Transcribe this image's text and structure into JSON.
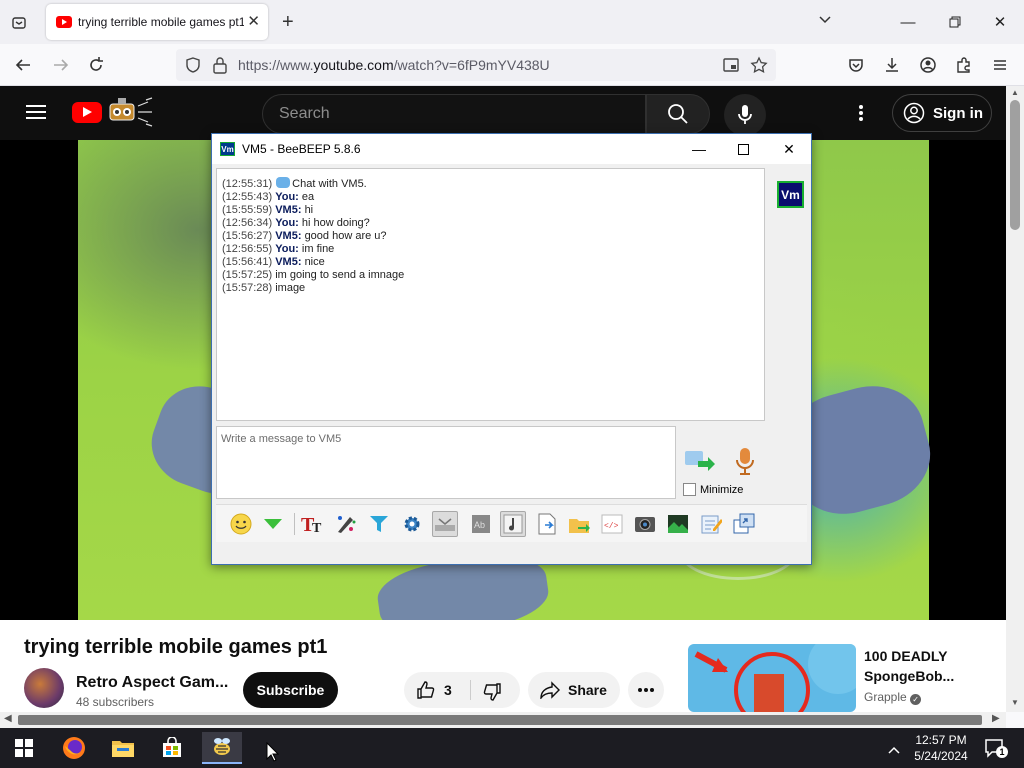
{
  "browser": {
    "tab_title": "trying terrible mobile games pt1",
    "url_prefix": "https://www.",
    "url_domain": "youtube.com",
    "url_suffix": "/watch?v=6fP9mYV438U"
  },
  "youtube": {
    "search_placeholder": "Search",
    "sign_in": "Sign in",
    "video_title": "trying terrible mobile games pt1",
    "channel_name": "Retro Aspect Gam...",
    "subscribers": "48 subscribers",
    "subscribe": "Subscribe",
    "likes": "3",
    "share": "Share",
    "rec_title": "100 DEADLY SpongeBob...",
    "rec_channel": "Grapple"
  },
  "beebeep": {
    "title": "VM5 - BeeBEEP 5.8.6",
    "avatar_text": "Vm",
    "ticon_text": "Vm",
    "messages": [
      {
        "time": "(12:55:31)",
        "who": "",
        "text": "Chat with VM5.",
        "icon": true
      },
      {
        "time": "(12:55:43)",
        "who": "You:",
        "text": "ea"
      },
      {
        "time": "(15:55:59)",
        "who": "VM5:",
        "text": "hi"
      },
      {
        "time": "(12:56:34)",
        "who": "You:",
        "text": "hi how doing?"
      },
      {
        "time": "(15:56:27)",
        "who": "VM5:",
        "text": "good how are u?"
      },
      {
        "time": "(12:56:55)",
        "who": "You:",
        "text": "im fine"
      },
      {
        "time": "(15:56:41)",
        "who": "VM5:",
        "text": "nice"
      },
      {
        "time": "(15:57:25)",
        "who": "",
        "text": "im going to send a imnage"
      },
      {
        "time": "(15:57:28)",
        "who": "",
        "text": "image"
      }
    ],
    "input_placeholder": "Write a message to VM5",
    "minimize_label": "Minimize"
  },
  "taskbar": {
    "time": "12:57 PM",
    "date": "5/24/2024",
    "notif_count": "1"
  },
  "colors": {
    "yt_red": "#ff0000",
    "bb_avatar_bg": "#0a0e6e",
    "bb_avatar_border": "#18b030"
  }
}
